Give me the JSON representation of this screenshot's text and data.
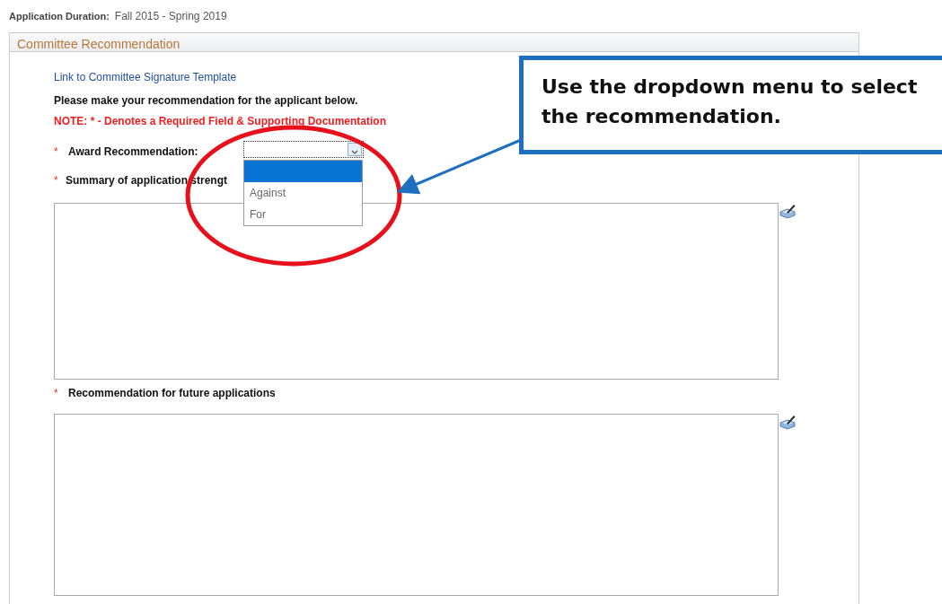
{
  "header": {
    "label": "Application Duration:",
    "value": "Fall 2015 - Spring 2019"
  },
  "panel": {
    "title": "Committee Recommendation",
    "link": "Link to Committee Signature Template",
    "instruction": "Please make your recommendation for the applicant below.",
    "note": "NOTE: * - Denotes a Required Field & Supporting Documentation",
    "fields": [
      {
        "kind": "select",
        "required_mark": "*",
        "label": "Award Recommendation:",
        "expanded": true,
        "options": [
          {
            "selected": true
          },
          {
            "label": "Against",
            "selected": false
          },
          {
            "label": "For",
            "selected": false
          }
        ]
      },
      {
        "kind": "textarea",
        "required_mark": "*",
        "label": "Summary of application strengt"
      },
      {
        "kind": "textarea",
        "required_mark": "*",
        "label": "Recommendation for future applications"
      }
    ]
  },
  "callout": {
    "text": "Use the dropdown menu to select the recommendation."
  }
}
